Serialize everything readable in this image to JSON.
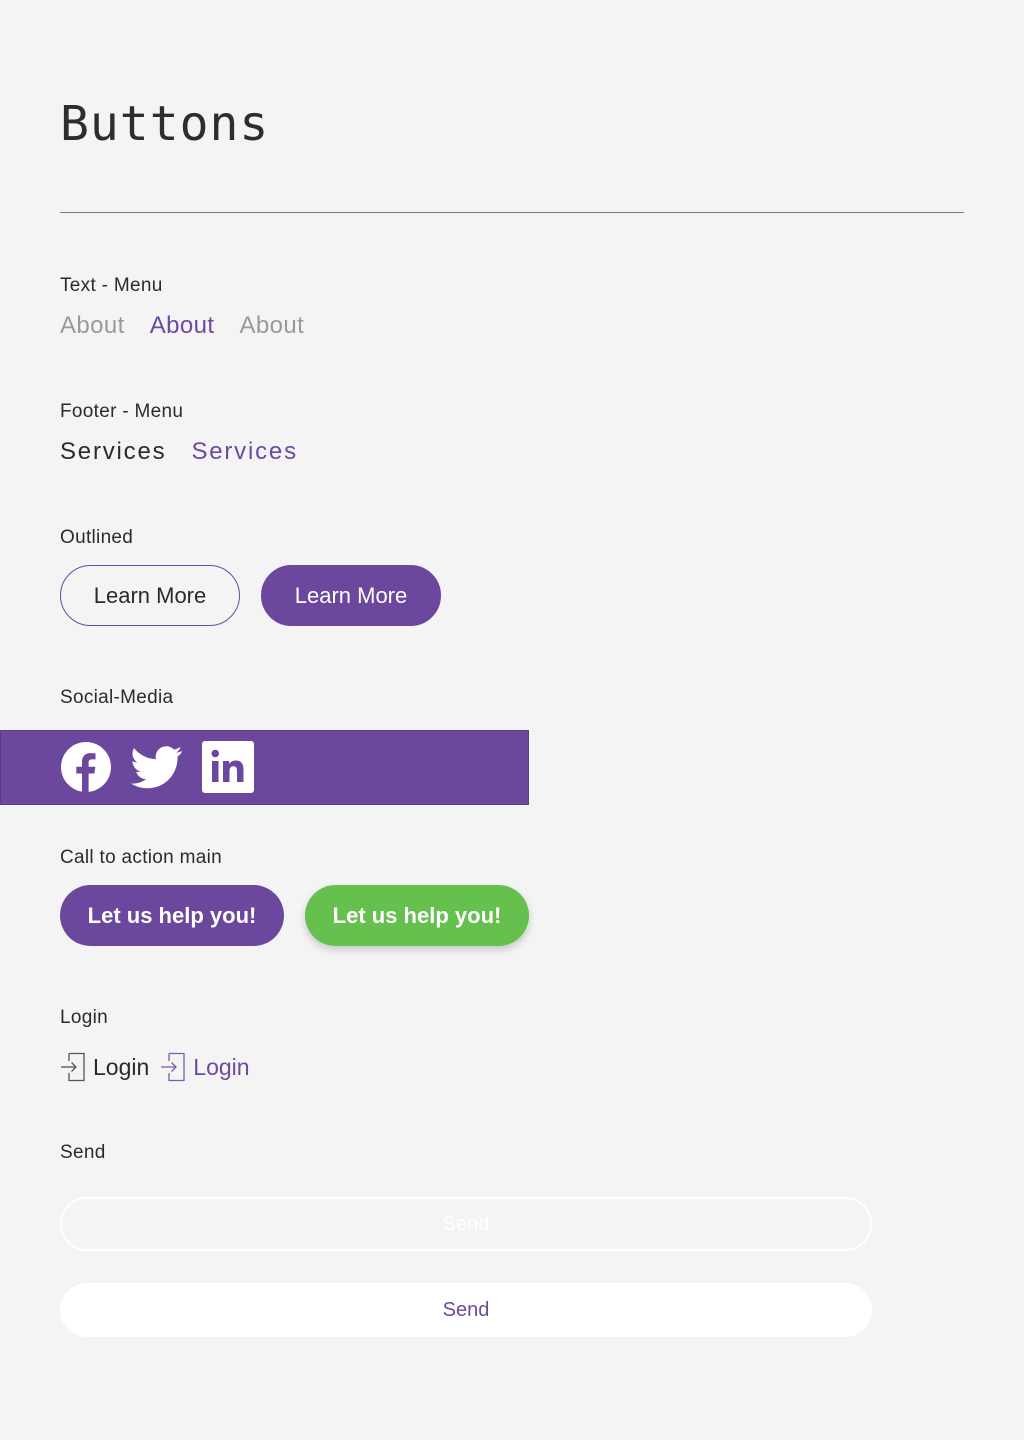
{
  "page": {
    "title": "Buttons"
  },
  "text_menu": {
    "label": "Text - Menu",
    "items": [
      "About",
      "About",
      "About"
    ]
  },
  "footer_menu": {
    "label": "Footer - Menu",
    "items": [
      "Services",
      "Services"
    ]
  },
  "outlined": {
    "label": "Outlined",
    "buttons": [
      "Learn More",
      "Learn More"
    ]
  },
  "social": {
    "label": "Social-Media",
    "icons": [
      "facebook-icon",
      "twitter-icon",
      "linkedin-icon"
    ]
  },
  "cta": {
    "label": "Call to action main",
    "buttons": [
      "Let us help you!",
      "Let us help you!"
    ]
  },
  "login": {
    "label": "Login",
    "items": [
      "Login",
      "Login"
    ]
  },
  "send": {
    "label": "Send",
    "buttons": [
      "Send",
      "Send"
    ]
  },
  "colors": {
    "primary": "#6c479e",
    "green": "#66c04d",
    "background": "#f4f4f4",
    "muted_text": "#9a9a9a"
  }
}
